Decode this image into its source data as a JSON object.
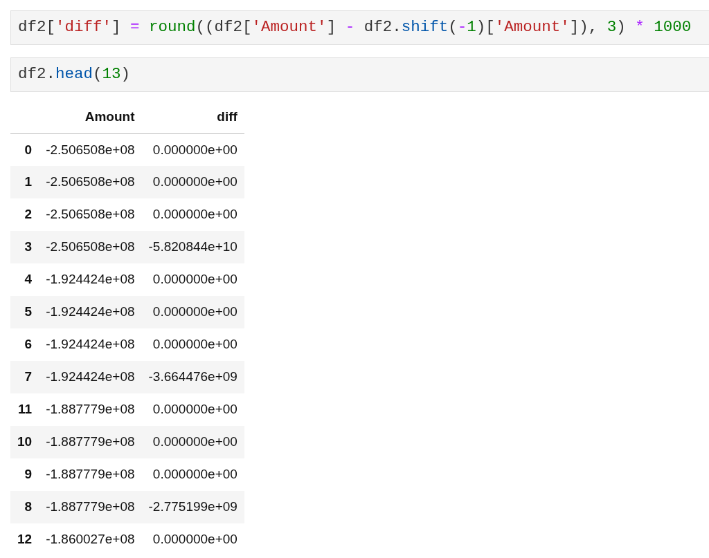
{
  "cells": [
    {
      "tokens": [
        {
          "kind": "name",
          "text": "df2["
        },
        {
          "kind": "string",
          "text": "'diff'"
        },
        {
          "kind": "name",
          "text": "] "
        },
        {
          "kind": "operator",
          "text": "= "
        },
        {
          "kind": "builtin",
          "text": "round"
        },
        {
          "kind": "name",
          "text": "((df2["
        },
        {
          "kind": "string",
          "text": "'Amount'"
        },
        {
          "kind": "name",
          "text": "] "
        },
        {
          "kind": "operator",
          "text": "-"
        },
        {
          "kind": "name",
          "text": " df2."
        },
        {
          "kind": "attr",
          "text": "shift"
        },
        {
          "kind": "name",
          "text": "("
        },
        {
          "kind": "operator",
          "text": "-"
        },
        {
          "kind": "number",
          "text": "1"
        },
        {
          "kind": "name",
          "text": ")["
        },
        {
          "kind": "string",
          "text": "'Amount'"
        },
        {
          "kind": "name",
          "text": "]), "
        },
        {
          "kind": "number",
          "text": "3"
        },
        {
          "kind": "name",
          "text": ") "
        },
        {
          "kind": "operator",
          "text": "* "
        },
        {
          "kind": "number",
          "text": "1000"
        }
      ]
    },
    {
      "tokens": [
        {
          "kind": "name",
          "text": "df2."
        },
        {
          "kind": "attr",
          "text": "head"
        },
        {
          "kind": "name",
          "text": "("
        },
        {
          "kind": "number",
          "text": "13"
        },
        {
          "kind": "name",
          "text": ")"
        }
      ]
    }
  ],
  "table": {
    "columns": [
      "Amount",
      "diff"
    ],
    "rows": [
      {
        "index": "0",
        "cells": [
          "-2.506508e+08",
          "0.000000e+00"
        ]
      },
      {
        "index": "1",
        "cells": [
          "-2.506508e+08",
          "0.000000e+00"
        ]
      },
      {
        "index": "2",
        "cells": [
          "-2.506508e+08",
          "0.000000e+00"
        ]
      },
      {
        "index": "3",
        "cells": [
          "-2.506508e+08",
          "-5.820844e+10"
        ]
      },
      {
        "index": "4",
        "cells": [
          "-1.924424e+08",
          "0.000000e+00"
        ]
      },
      {
        "index": "5",
        "cells": [
          "-1.924424e+08",
          "0.000000e+00"
        ]
      },
      {
        "index": "6",
        "cells": [
          "-1.924424e+08",
          "0.000000e+00"
        ]
      },
      {
        "index": "7",
        "cells": [
          "-1.924424e+08",
          "-3.664476e+09"
        ]
      },
      {
        "index": "11",
        "cells": [
          "-1.887779e+08",
          "0.000000e+00"
        ]
      },
      {
        "index": "10",
        "cells": [
          "-1.887779e+08",
          "0.000000e+00"
        ]
      },
      {
        "index": "9",
        "cells": [
          "-1.887779e+08",
          "0.000000e+00"
        ]
      },
      {
        "index": "8",
        "cells": [
          "-1.887779e+08",
          "-2.775199e+09"
        ]
      },
      {
        "index": "12",
        "cells": [
          "-1.860027e+08",
          "0.000000e+00"
        ]
      }
    ]
  }
}
